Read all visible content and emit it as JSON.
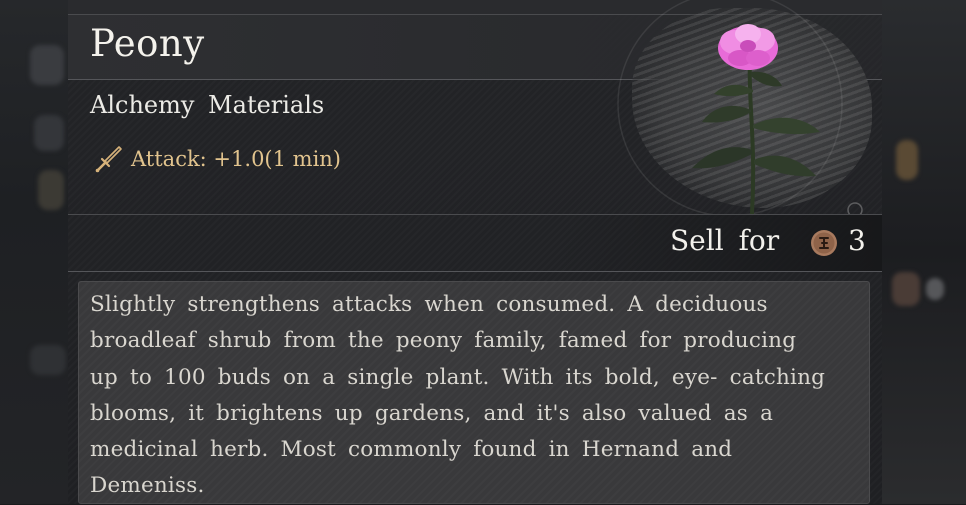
{
  "item": {
    "name": "Peony",
    "category": "Alchemy Materials",
    "effect": "Attack: +1.0(1 min)",
    "effect_icon": "dagger-icon",
    "flower_color": "#e86bd8",
    "sell_label": "Sell for",
    "sell_value": "3",
    "currency_icon": "coin-icon",
    "description": "Slightly strengthens attacks when consumed. A deciduous broadleaf shrub from the peony family, famed for producing up to 100 buds on a single plant. With its bold, eye- catching blooms, it brightens up gardens, and it's also valued as a medicinal herb. Most commonly found in Hernand and Demeniss."
  },
  "colors": {
    "title": "#f4f2ec",
    "effect": "#e2c48e",
    "description": "#d9d6cf",
    "panel": "#232427",
    "desc_box": "#39393b"
  }
}
